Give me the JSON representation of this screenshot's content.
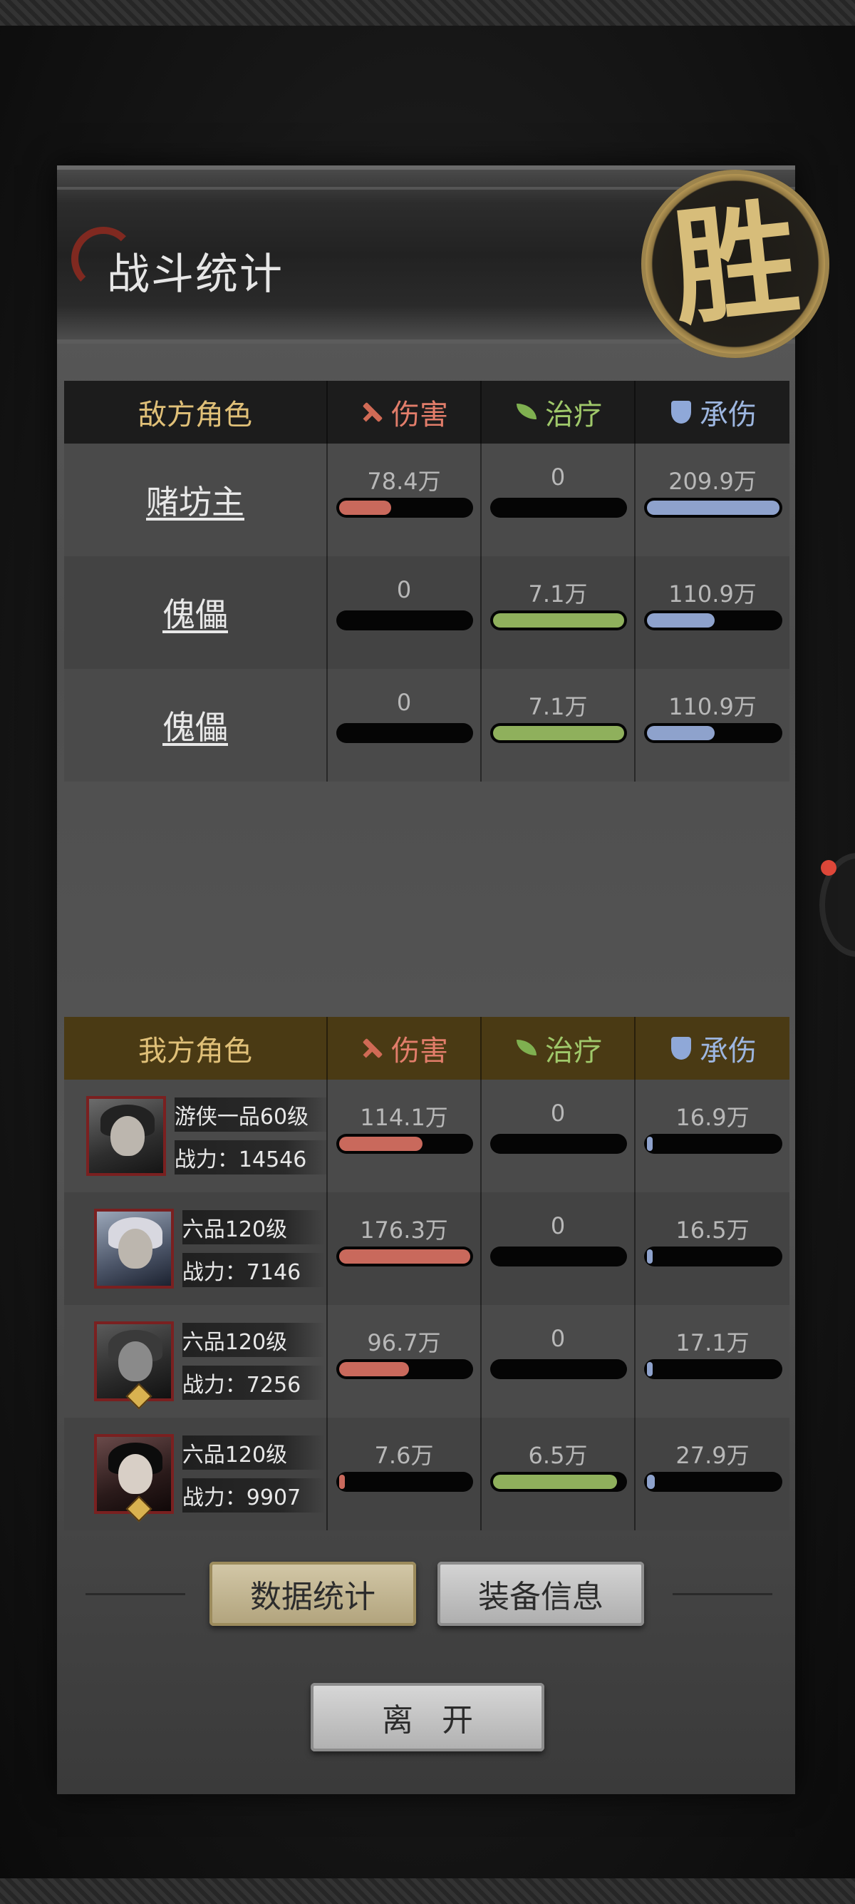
{
  "header": {
    "title": "战斗统计",
    "result_seal": "胜"
  },
  "columns": {
    "damage": "伤害",
    "heal": "治疗",
    "tank": "承伤"
  },
  "enemy": {
    "header": "敌方角色",
    "rows": [
      {
        "name": "赌坊主",
        "damage": "78.4万",
        "damage_pct": 42,
        "heal": "0",
        "heal_pct": 0,
        "tank": "209.9万",
        "tank_pct": 100
      },
      {
        "name": "傀儡",
        "damage": "0",
        "damage_pct": 0,
        "heal": "7.1万",
        "heal_pct": 100,
        "tank": "110.9万",
        "tank_pct": 53
      },
      {
        "name": "傀儡",
        "damage": "0",
        "damage_pct": 0,
        "heal": "7.1万",
        "heal_pct": 100,
        "tank": "110.9万",
        "tank_pct": 53
      }
    ]
  },
  "ally": {
    "header": "我方角色",
    "rows": [
      {
        "rank": "游侠一品60级",
        "power": "战力：14546",
        "damage": "114.1万",
        "damage_pct": 65,
        "heal": "0",
        "heal_pct": 0,
        "tank": "16.9万",
        "tank_pct": 4
      },
      {
        "rank": "六品120级",
        "power": "战力：7146",
        "damage": "176.3万",
        "damage_pct": 100,
        "heal": "0",
        "heal_pct": 0,
        "tank": "16.5万",
        "tank_pct": 4
      },
      {
        "rank": "六品120级",
        "power": "战力：7256",
        "damage": "96.7万",
        "damage_pct": 55,
        "heal": "0",
        "heal_pct": 0,
        "tank": "17.1万",
        "tank_pct": 4
      },
      {
        "rank": "六品120级",
        "power": "战力：9907",
        "damage": "7.6万",
        "damage_pct": 4,
        "heal": "6.5万",
        "heal_pct": 95,
        "tank": "27.9万",
        "tank_pct": 10
      }
    ]
  },
  "buttons": {
    "stats": "数据统计",
    "equipment": "装备信息",
    "leave": "离开"
  }
}
